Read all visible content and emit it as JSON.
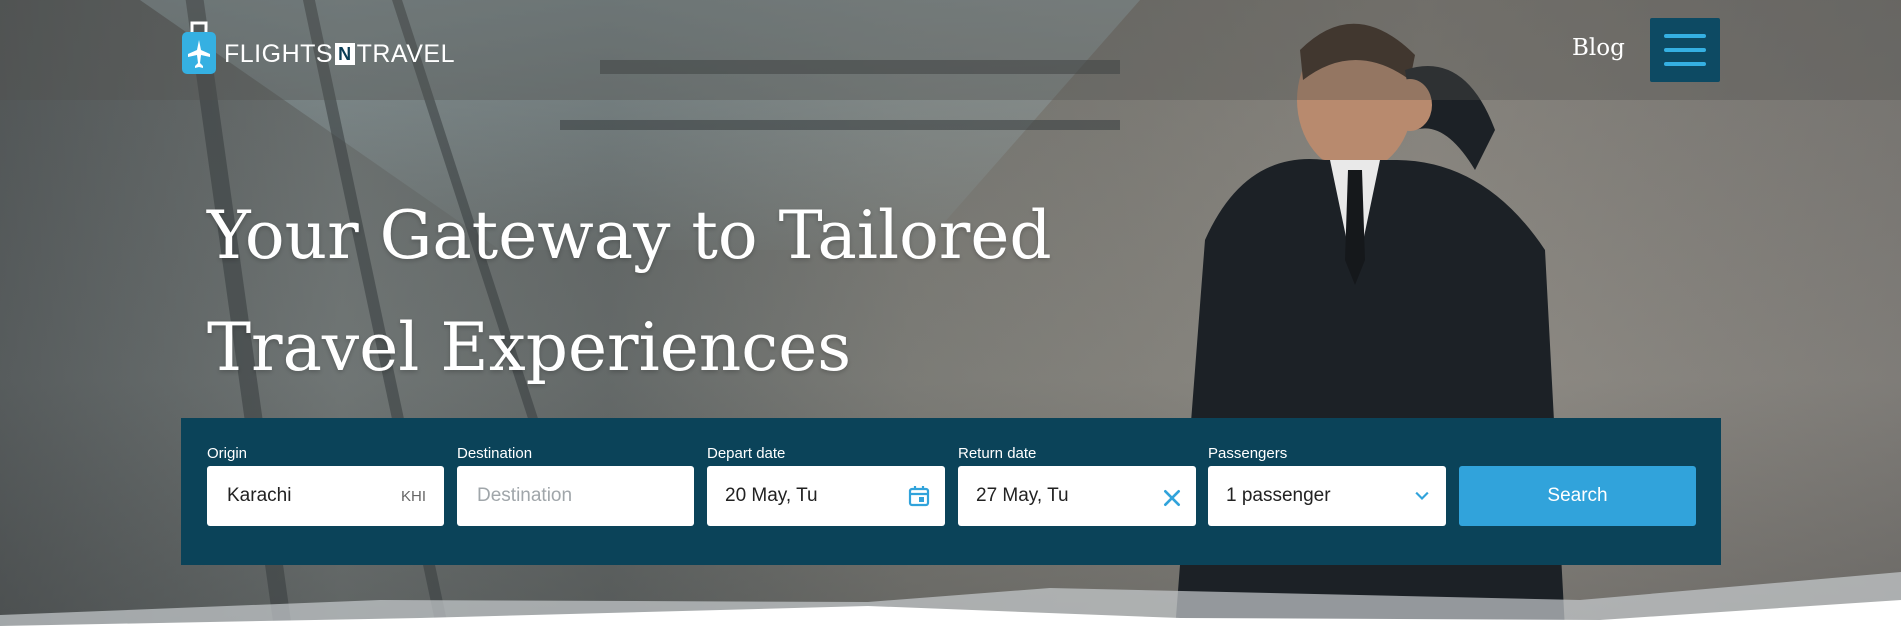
{
  "header": {
    "logo_text_left": "FLIGHTS",
    "logo_text_n": "N",
    "logo_text_right": "TRAVEL",
    "blog_label": "Blog",
    "menu_icon": "hamburger-menu-icon"
  },
  "hero": {
    "headline_line1": "Your Gateway to Tailored",
    "headline_line2": "Travel Experiences"
  },
  "search": {
    "origin": {
      "label": "Origin",
      "value": "Karachi",
      "code": "KHI"
    },
    "destination": {
      "label": "Destination",
      "value": "",
      "placeholder": "Destination"
    },
    "depart": {
      "label": "Depart date",
      "value": "20 May, Tu",
      "icon": "calendar-icon"
    },
    "return": {
      "label": "Return date",
      "value": "27 May, Tu",
      "icon": "clear-x-icon"
    },
    "passengers": {
      "label": "Passengers",
      "value": "1 passenger",
      "icon": "chevron-down-icon"
    },
    "button_label": "Search"
  },
  "colors": {
    "panel": "#0b4359",
    "accent": "#31a3db",
    "menu_button": "#0d4a63"
  }
}
